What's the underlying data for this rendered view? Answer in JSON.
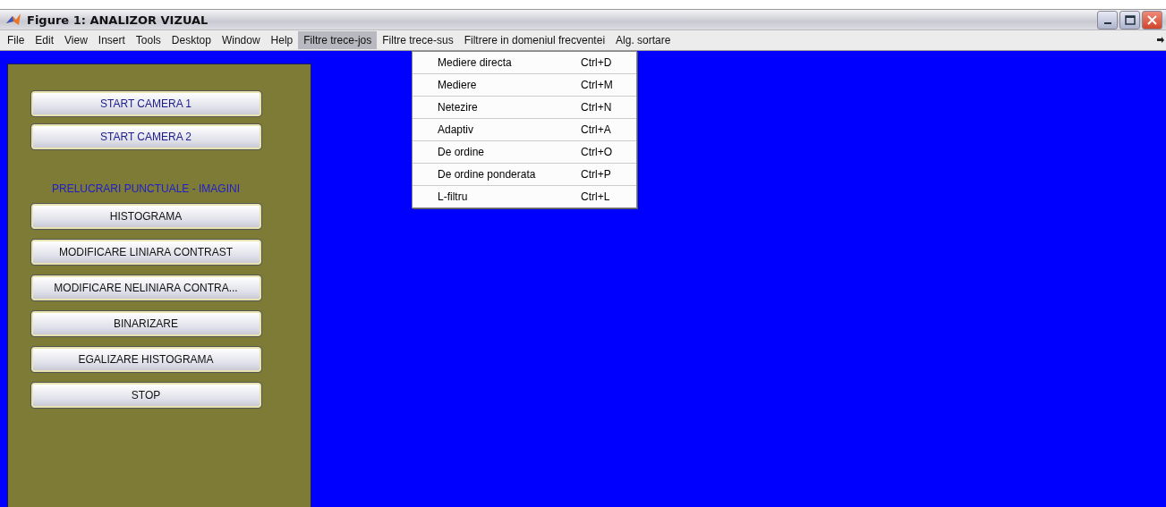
{
  "window": {
    "title": "Figure 1: ANALIZOR VIZUAL"
  },
  "menu_bar": [
    {
      "label": "File",
      "selected": false
    },
    {
      "label": "Edit",
      "selected": false
    },
    {
      "label": "View",
      "selected": false
    },
    {
      "label": "Insert",
      "selected": false
    },
    {
      "label": "Tools",
      "selected": false
    },
    {
      "label": "Desktop",
      "selected": false
    },
    {
      "label": "Window",
      "selected": false
    },
    {
      "label": "Help",
      "selected": false
    },
    {
      "label": "Filtre trece-jos",
      "selected": true
    },
    {
      "label": "Filtre trece-sus",
      "selected": false
    },
    {
      "label": "Filtrere in domeniul frecventei",
      "selected": false
    },
    {
      "label": "Alg. sortare",
      "selected": false
    }
  ],
  "dropdown_menu": [
    {
      "label": "Mediere directa",
      "shortcut": "Ctrl+D"
    },
    {
      "label": "Mediere",
      "shortcut": "Ctrl+M"
    },
    {
      "label": "Netezire",
      "shortcut": "Ctrl+N"
    },
    {
      "label": "Adaptiv",
      "shortcut": "Ctrl+A"
    },
    {
      "label": "De ordine",
      "shortcut": "Ctrl+O"
    },
    {
      "label": "De ordine ponderata",
      "shortcut": "Ctrl+P"
    },
    {
      "label": "L-filtru",
      "shortcut": "Ctrl+L"
    }
  ],
  "control_panel": [
    {
      "kind": "button",
      "label": "START CAMERA 1",
      "color": "#1c1c8c"
    },
    {
      "kind": "button",
      "label": "START CAMERA 2",
      "color": "#1c1c8c"
    },
    {
      "kind": "label",
      "label": "PRELUCRARI PUNCTUALE - IMAGINI",
      "color": "#2020c8"
    },
    {
      "kind": "button",
      "label": "HISTOGRAMA",
      "color": "#111111"
    },
    {
      "kind": "button",
      "label": "MODIFICARE LINIARA CONTRAST",
      "color": "#111111"
    },
    {
      "kind": "button",
      "label": "MODIFICARE NELINIARA CONTRA...",
      "color": "#111111"
    },
    {
      "kind": "button",
      "label": "BINARIZARE",
      "color": "#111111"
    },
    {
      "kind": "button",
      "label": "EGALIZARE HISTOGRAMA",
      "color": "#111111"
    },
    {
      "kind": "button",
      "label": "STOP",
      "color": "#111111"
    }
  ]
}
